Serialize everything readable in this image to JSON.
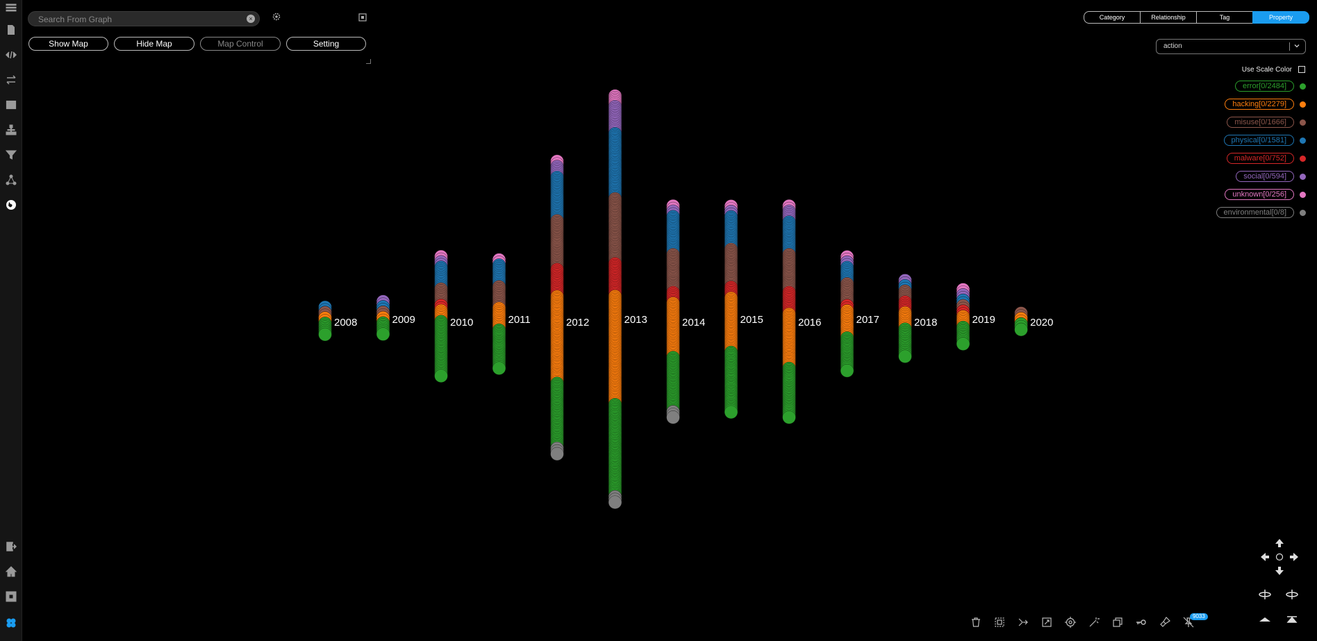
{
  "sidebar": {
    "items": [
      {
        "name": "menu-icon"
      },
      {
        "name": "file-icon"
      },
      {
        "name": "code-icon"
      },
      {
        "name": "swap-icon"
      },
      {
        "name": "table-icon"
      },
      {
        "name": "hierarchy-icon"
      },
      {
        "name": "filter-icon"
      },
      {
        "name": "network-icon"
      },
      {
        "name": "globe-icon"
      }
    ],
    "bottom_items": [
      {
        "name": "logout-icon"
      },
      {
        "name": "home-icon"
      },
      {
        "name": "puzzle-icon"
      },
      {
        "name": "app-logo-icon"
      }
    ]
  },
  "search": {
    "placeholder": "Search From Graph"
  },
  "buttons": {
    "show_map": "Show Map",
    "hide_map": "Hide Map",
    "map_control": "Map Control",
    "setting": "Setting"
  },
  "tabs": [
    {
      "label": "Category",
      "active": false
    },
    {
      "label": "Relationship",
      "active": false
    },
    {
      "label": "Tag",
      "active": false
    },
    {
      "label": "Property",
      "active": true
    }
  ],
  "property_select": {
    "value": "action"
  },
  "scale_color": {
    "label": "Use Scale Color",
    "checked": false
  },
  "legend": [
    {
      "label": "error[0/2484]",
      "color": "#2ca02c"
    },
    {
      "label": "hacking[0/2279]",
      "color": "#ff7f0e"
    },
    {
      "label": "misuse[0/1666]",
      "color": "#8c564b"
    },
    {
      "label": "physical[0/1581]",
      "color": "#1f77b4"
    },
    {
      "label": "malware[0/752]",
      "color": "#d62728"
    },
    {
      "label": "social[0/594]",
      "color": "#9467bd"
    },
    {
      "label": "unknown[0/256]",
      "color": "#e377c2"
    },
    {
      "label": "environmental[0/8]",
      "color": "#7f7f7f"
    }
  ],
  "chart_data": {
    "type": "bar",
    "categories": [
      "2008",
      "2009",
      "2010",
      "2011",
      "2012",
      "2013",
      "2014",
      "2015",
      "2016",
      "2017",
      "2018",
      "2019",
      "2020"
    ],
    "series": [
      {
        "name": "error",
        "values": [
          2,
          2,
          10,
          7,
          12,
          17,
          10,
          11,
          9,
          6,
          5,
          3,
          1
        ]
      },
      {
        "name": "hacking",
        "values": [
          1,
          1,
          2,
          4,
          16,
          20,
          10,
          10,
          10,
          5,
          3,
          2,
          1
        ]
      },
      {
        "name": "malware",
        "values": [
          0,
          0,
          1,
          0,
          5,
          6,
          2,
          2,
          4,
          1,
          2,
          1,
          0
        ]
      },
      {
        "name": "misuse",
        "values": [
          1,
          1,
          3,
          4,
          9,
          12,
          7,
          7,
          7,
          4,
          2,
          1,
          1
        ]
      },
      {
        "name": "physical",
        "values": [
          1,
          1,
          4,
          4,
          8,
          12,
          7,
          6,
          6,
          3,
          1,
          1,
          0
        ]
      },
      {
        "name": "social",
        "values": [
          0,
          1,
          1,
          0,
          2,
          5,
          1,
          1,
          2,
          1,
          1,
          1,
          0
        ]
      },
      {
        "name": "unknown",
        "values": [
          0,
          0,
          1,
          1,
          1,
          2,
          1,
          1,
          1,
          1,
          0,
          1,
          0
        ]
      },
      {
        "name": "environmental",
        "values": [
          0,
          0,
          0,
          0,
          1,
          1,
          1,
          0,
          0,
          0,
          0,
          0,
          0
        ]
      }
    ]
  },
  "toolbar": {
    "icons": [
      {
        "name": "trash-icon"
      },
      {
        "name": "select-box-icon"
      },
      {
        "name": "connect-icon"
      },
      {
        "name": "expand-icon"
      },
      {
        "name": "target-icon"
      },
      {
        "name": "magic-icon"
      },
      {
        "name": "duplicate-icon"
      },
      {
        "name": "key-icon"
      },
      {
        "name": "brush-icon"
      },
      {
        "name": "pin-off-icon"
      }
    ],
    "badge": "9033"
  }
}
